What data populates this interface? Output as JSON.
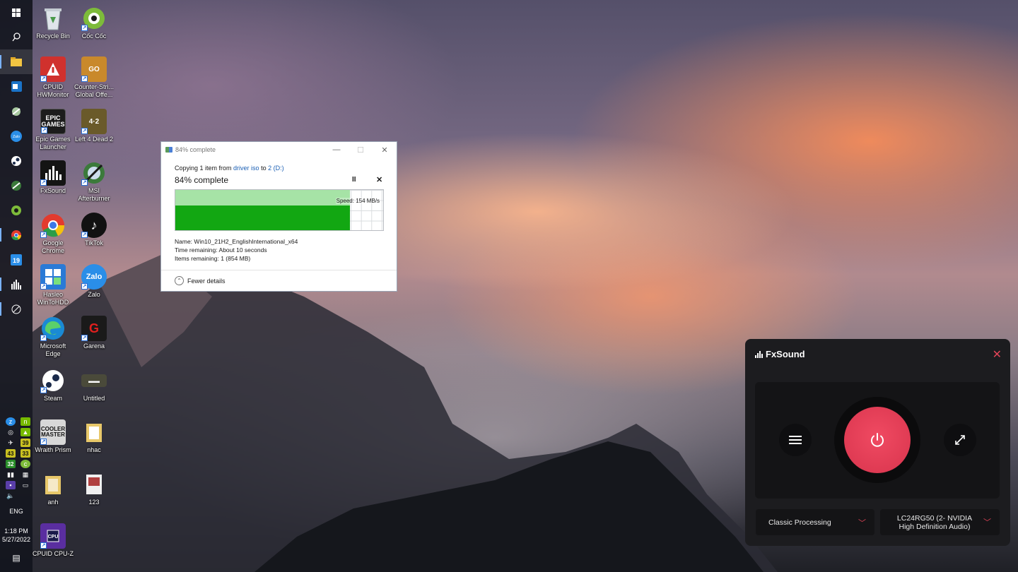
{
  "taskbar": {
    "apps": [
      {
        "name": "start",
        "icon": "windows-icon"
      },
      {
        "name": "search",
        "icon": "search-icon"
      },
      {
        "name": "file-explorer",
        "icon": "folder-icon",
        "active": true
      },
      {
        "name": "outlook",
        "icon": "outlook-icon"
      },
      {
        "name": "app5",
        "icon": "app-icon"
      },
      {
        "name": "zalo",
        "icon": "zalo-icon"
      },
      {
        "name": "steam",
        "icon": "steam-icon"
      },
      {
        "name": "msi-afterburner",
        "icon": "afterburner-icon"
      },
      {
        "name": "coc-coc",
        "icon": "coccoc-icon"
      },
      {
        "name": "chrome",
        "icon": "chrome-icon"
      },
      {
        "name": "app19",
        "icon": "calendar-icon"
      },
      {
        "name": "fxsound",
        "icon": "fxsound-icon"
      },
      {
        "name": "app-satellite",
        "icon": "satellite-icon"
      }
    ],
    "tray": {
      "temps": [
        "39",
        "43",
        "33",
        "32"
      ],
      "language": "ENG",
      "time": "1:18 PM",
      "date": "5/27/2022"
    }
  },
  "desktop": {
    "icons": [
      {
        "label": "Recycle Bin",
        "color": "#d8dde3"
      },
      {
        "label": "Cốc Cốc",
        "color": "#7dbb3a"
      },
      {
        "label": "CPUID HWMonitor",
        "color": "#d0312d"
      },
      {
        "label": "Counter-Stri... Global Offe...",
        "color": "#c9892b"
      },
      {
        "label": "Epic Games Launcher",
        "color": "#1c1c1c"
      },
      {
        "label": "Left 4 Dead 2",
        "color": "#6a5a2a"
      },
      {
        "label": "FxSound",
        "color": "#141414"
      },
      {
        "label": "MSI Afterburner",
        "color": "#3b7a3b"
      },
      {
        "label": "Google Chrome",
        "color": "#e8e8e8"
      },
      {
        "label": "TikTok",
        "color": "#111111"
      },
      {
        "label": "Hasleo WinToHDD",
        "color": "#2a7ad6"
      },
      {
        "label": "Zalo",
        "color": "#2a8ee8"
      },
      {
        "label": "Microsoft Edge",
        "color": "#1a8ad4"
      },
      {
        "label": "Garena",
        "color": "#c81e1e"
      },
      {
        "label": "Steam",
        "color": "#1a2a4a"
      },
      {
        "label": "Untitled",
        "color": "#4a4a3a"
      },
      {
        "label": "Wraith Prism",
        "color": "#d8d8d8"
      },
      {
        "label": "nhac",
        "color": "#e8c86a"
      },
      {
        "label": "anh",
        "color": "#e8c86a"
      },
      {
        "label": "123",
        "color": "#f0f0f0"
      },
      {
        "label": "CPUID CPU-Z",
        "color": "#5a2ea0"
      }
    ]
  },
  "copy_dialog": {
    "title": "84% complete",
    "line_prefix": "Copying 1 item from",
    "source": "driver iso",
    "line_mid": "to",
    "destination": "2 (D:)",
    "percent_text": "84% complete",
    "progress": 0.84,
    "speed": "Speed: 154 MB/s",
    "name_label": "Name:",
    "name_value": "Win10_21H2_EnglishInternational_x64",
    "time_label": "Time remaining:",
    "time_value": "About 10 seconds",
    "items_label": "Items remaining:",
    "items_value": "1 (854 MB)",
    "fewer_details": "Fewer details"
  },
  "fxsound": {
    "title": "FxSound",
    "accent": "#e04457",
    "preset": "Classic Processing",
    "output_device": "LC24RG50 (2- NVIDIA High Definition Audio)"
  }
}
